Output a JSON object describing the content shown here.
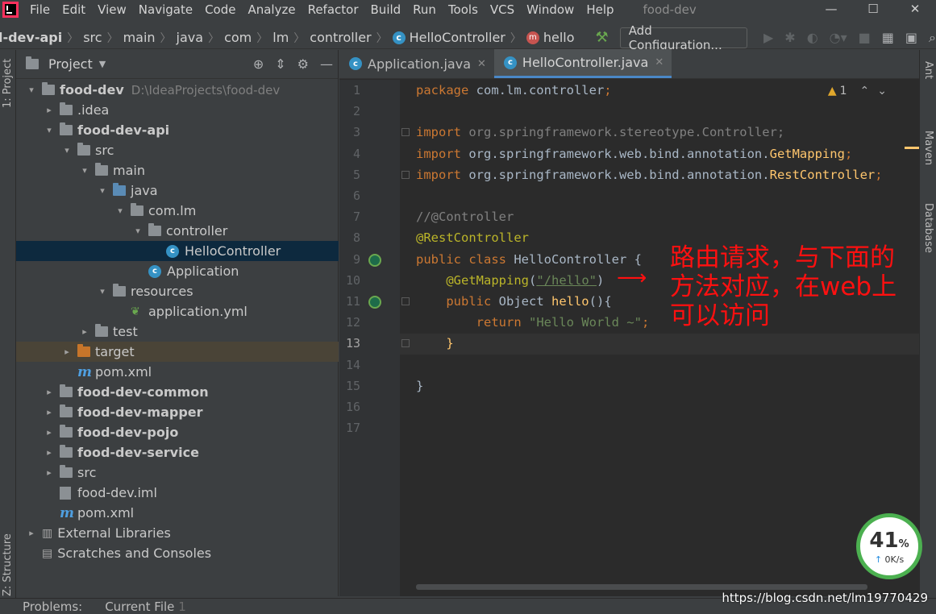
{
  "menubar": {
    "items": [
      "File",
      "Edit",
      "View",
      "Navigate",
      "Code",
      "Analyze",
      "Refactor",
      "Build",
      "Run",
      "Tools",
      "VCS",
      "Window",
      "Help"
    ],
    "project_title": "food-dev"
  },
  "navbar": {
    "crumbs": [
      "d-dev-api",
      "src",
      "main",
      "java",
      "com",
      "lm",
      "controller",
      "HelloController",
      "hello"
    ],
    "add_config_label": "Add Configuration..."
  },
  "left_strip": {
    "project_label": "1: Project",
    "structure_label": "Z: Structure"
  },
  "right_strip": {
    "ant_label": "Ant",
    "maven_label": "Maven",
    "database_label": "Database"
  },
  "project_panel": {
    "title": "Project",
    "root_path": "D:\\IdeaProjects\\food-dev",
    "tree": [
      {
        "label": "food-dev",
        "depth": 0,
        "expanded": true,
        "kind": "folder",
        "bold": true
      },
      {
        "label": ".idea",
        "depth": 1,
        "expanded": false,
        "kind": "folder"
      },
      {
        "label": "food-dev-api",
        "depth": 1,
        "expanded": true,
        "kind": "folder",
        "bold": true
      },
      {
        "label": "src",
        "depth": 2,
        "expanded": true,
        "kind": "folder"
      },
      {
        "label": "main",
        "depth": 3,
        "expanded": true,
        "kind": "folder"
      },
      {
        "label": "java",
        "depth": 4,
        "expanded": true,
        "kind": "folder-blue"
      },
      {
        "label": "com.lm",
        "depth": 5,
        "expanded": true,
        "kind": "package"
      },
      {
        "label": "controller",
        "depth": 6,
        "expanded": true,
        "kind": "package"
      },
      {
        "label": "HelloController",
        "depth": 7,
        "kind": "class",
        "selected": true
      },
      {
        "label": "Application",
        "depth": 6,
        "kind": "class-app"
      },
      {
        "label": "resources",
        "depth": 4,
        "expanded": true,
        "kind": "folder-res"
      },
      {
        "label": "application.yml",
        "depth": 5,
        "kind": "yml"
      },
      {
        "label": "test",
        "depth": 3,
        "expanded": false,
        "kind": "folder"
      },
      {
        "label": "target",
        "depth": 2,
        "expanded": false,
        "kind": "folder-orange",
        "highlight": true
      },
      {
        "label": "pom.xml",
        "depth": 2,
        "kind": "maven"
      },
      {
        "label": "food-dev-common",
        "depth": 1,
        "expanded": false,
        "kind": "folder",
        "bold": true
      },
      {
        "label": "food-dev-mapper",
        "depth": 1,
        "expanded": false,
        "kind": "folder",
        "bold": true
      },
      {
        "label": "food-dev-pojo",
        "depth": 1,
        "expanded": false,
        "kind": "folder",
        "bold": true
      },
      {
        "label": "food-dev-service",
        "depth": 1,
        "expanded": false,
        "kind": "folder",
        "bold": true
      },
      {
        "label": "src",
        "depth": 1,
        "expanded": false,
        "kind": "folder"
      },
      {
        "label": "food-dev.iml",
        "depth": 1,
        "kind": "iml"
      },
      {
        "label": "pom.xml",
        "depth": 1,
        "kind": "maven"
      },
      {
        "label": "External Libraries",
        "depth": 0,
        "expanded": false,
        "kind": "lib"
      },
      {
        "label": "Scratches and Consoles",
        "depth": 0,
        "kind": "scratch"
      }
    ]
  },
  "editor": {
    "tabs": [
      {
        "label": "Application.java",
        "active": false
      },
      {
        "label": "HelloController.java",
        "active": true
      }
    ],
    "warning_count": "1",
    "current_line": 13,
    "lines": [
      [
        [
          "kw",
          "package "
        ],
        [
          "pl",
          "com.lm.controller"
        ],
        [
          "kw",
          ";"
        ]
      ],
      [],
      [
        [
          "kw",
          "import "
        ],
        [
          "gr",
          "org.springframework.stereotype.Controller;"
        ]
      ],
      [
        [
          "kw",
          "import "
        ],
        [
          "pl",
          "org.springframework.web.bind.annotation."
        ],
        [
          "yl",
          "GetMapping"
        ],
        [
          "kw",
          ";"
        ]
      ],
      [
        [
          "kw",
          "import "
        ],
        [
          "pl",
          "org.springframework.web.bind.annotation."
        ],
        [
          "yl",
          "RestController"
        ],
        [
          "kw",
          ";"
        ]
      ],
      [],
      [
        [
          "gr",
          "//@Controller"
        ]
      ],
      [
        [
          "ann",
          "@RestController"
        ]
      ],
      [
        [
          "kw",
          "public class "
        ],
        [
          "pl",
          "HelloController {"
        ]
      ],
      [
        [
          "ann",
          "    @GetMapping"
        ],
        [
          "pl",
          "("
        ],
        [
          "str",
          "\"/hello\""
        ],
        [
          "pl",
          ")"
        ]
      ],
      [
        [
          "kw",
          "    public "
        ],
        [
          "pl",
          "Object "
        ],
        [
          "fn",
          "hello"
        ],
        [
          "pl",
          "(){"
        ]
      ],
      [
        [
          "kw",
          "        return "
        ],
        [
          "str",
          "\"Hello World ~\""
        ],
        [
          "kw",
          ";"
        ]
      ],
      [
        [
          "yl",
          "    }"
        ]
      ],
      [],
      [
        [
          "pl",
          "}"
        ]
      ],
      [],
      []
    ]
  },
  "annotation": {
    "lines": [
      "路由请求，与下面的",
      "方法对应，在web上",
      "可以访问"
    ]
  },
  "speed_widget": {
    "percent": "41",
    "percent_sign": "%",
    "rate": "0K/s"
  },
  "statusbar": {
    "problems_label": "Problems:",
    "current_file_label": "Current File",
    "current_file_count": "1"
  },
  "watermark": "https://blog.csdn.net/lm19770429"
}
